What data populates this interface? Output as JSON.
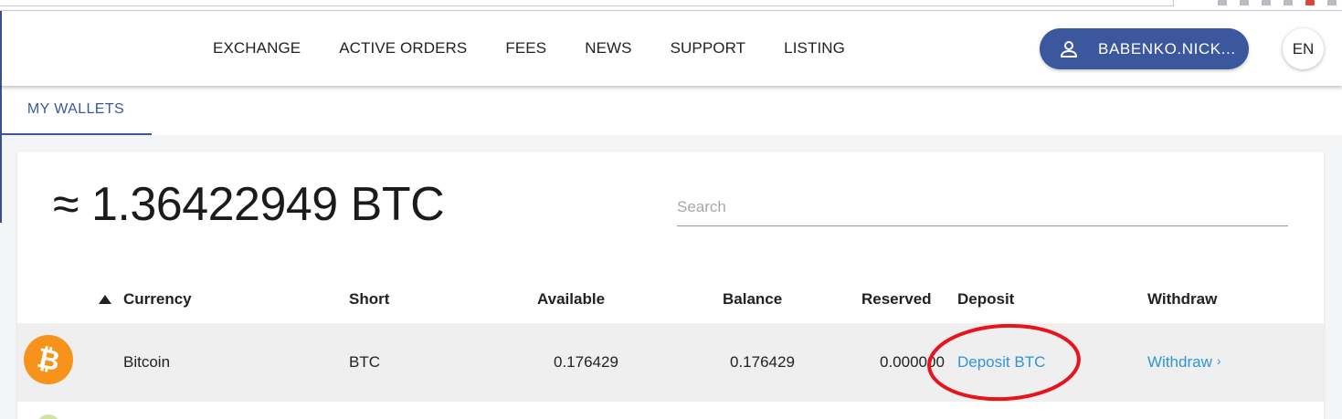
{
  "nav": {
    "items": [
      "EXCHANGE",
      "ACTIVE ORDERS",
      "FEES",
      "NEWS",
      "SUPPORT",
      "LISTING"
    ]
  },
  "user": {
    "name": "BABENKO.NICK...",
    "icon": "user-icon"
  },
  "lang": {
    "label": "EN"
  },
  "tabs": [
    {
      "label": "MY WALLETS",
      "active": true
    }
  ],
  "wallet": {
    "total": "≈ 1.36422949 BTC",
    "search_placeholder": "Search"
  },
  "table": {
    "headers": [
      "Currency",
      "Short",
      "Available",
      "Balance",
      "Reserved",
      "Deposit",
      "Withdraw"
    ],
    "rows": [
      {
        "icon": "bitcoin-icon",
        "currency": "Bitcoin",
        "short": "BTC",
        "available": "0.176429",
        "balance": "0.176429",
        "reserved": "0.000000",
        "deposit": "Deposit BTC",
        "withdraw": "Withdraw"
      }
    ]
  },
  "colors": {
    "brand": "#3b579d",
    "link": "#2f95d6",
    "bitcoin": "#f7931a",
    "highlight_ellipse": "#e8141c"
  }
}
